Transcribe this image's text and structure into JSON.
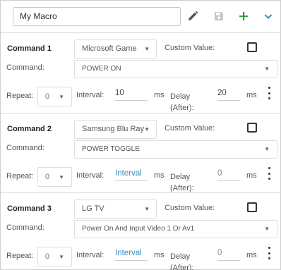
{
  "macro": {
    "name": "My Macro"
  },
  "header_icons": [
    "pencil-icon",
    "save-icon",
    "plus-icon",
    "chevron-down-icon"
  ],
  "colors": {
    "accent_green": "#2e9e3a",
    "pencil": "#4a5766",
    "chevron": "#2f7fa8",
    "disabled": "#c8c8c8",
    "link_blue": "#3a8fc0"
  },
  "labels": {
    "custom_value": "Custom Value:",
    "command": "Command:",
    "repeat": "Repeat:",
    "interval": "Interval:",
    "ms": "ms",
    "delay_line1": "Delay",
    "delay_line2": "(After):"
  },
  "commands": [
    {
      "title": "Command 1",
      "device": "Microsoft Game",
      "command": "POWER ON",
      "repeat": "0",
      "interval": "10",
      "interval_placeholder": false,
      "delay": "20",
      "delay_placeholder": false,
      "custom_value_checked": false
    },
    {
      "title": "Command 2",
      "device": "Samsung Blu Ray",
      "command": "POWER TOGGLE",
      "repeat": "0",
      "interval": "Interval",
      "interval_placeholder": true,
      "delay": "0",
      "delay_placeholder": true,
      "custom_value_checked": false
    },
    {
      "title": "Command 3",
      "device": "LG TV",
      "command": "Power On And Input Video 1 Or Av1",
      "repeat": "0",
      "interval": "Interval",
      "interval_placeholder": true,
      "delay": "0",
      "delay_placeholder": true,
      "custom_value_checked": false
    }
  ]
}
